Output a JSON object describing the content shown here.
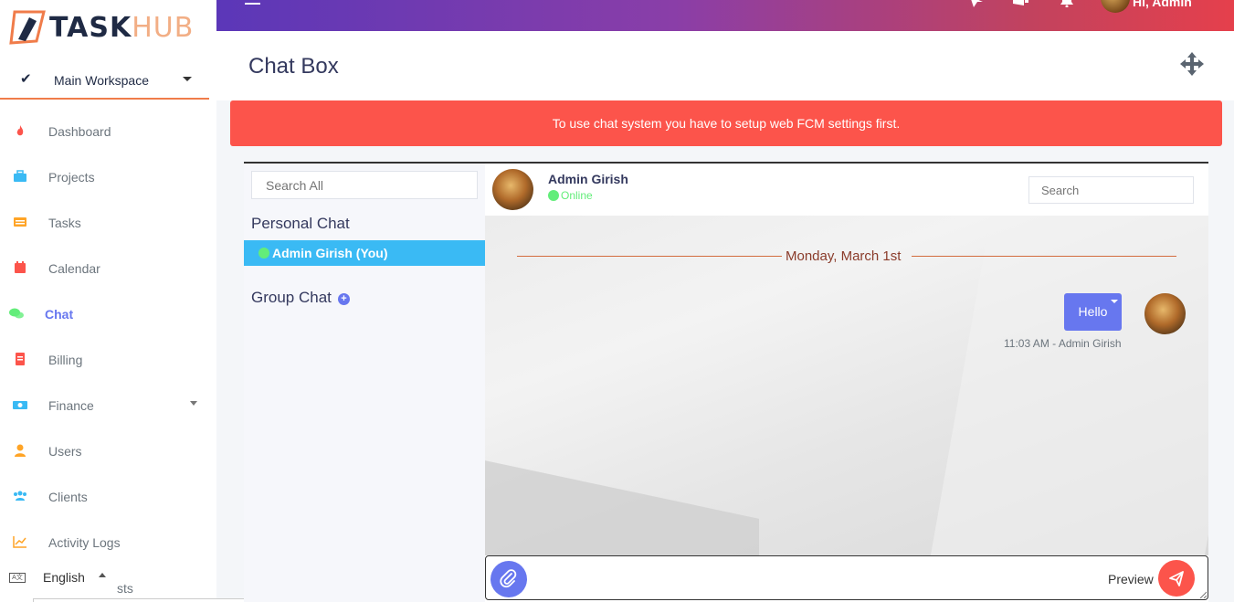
{
  "brand": {
    "name_bold": "TASK",
    "name_light": "HUB"
  },
  "workspace": {
    "label": "Main Workspace"
  },
  "sidebar": {
    "items": [
      {
        "label": "Dashboard",
        "icon": "fire-icon",
        "color": "#fc544b"
      },
      {
        "label": "Projects",
        "icon": "briefcase-icon",
        "color": "#3abaf4"
      },
      {
        "label": "Tasks",
        "icon": "list-icon",
        "color": "#ffa426"
      },
      {
        "label": "Calendar",
        "icon": "calendar-icon",
        "color": "#fc544b"
      },
      {
        "label": "Chat",
        "icon": "comments-icon",
        "color": "#63ed7a"
      },
      {
        "label": "Billing",
        "icon": "receipt-icon",
        "color": "#fc544b"
      },
      {
        "label": "Finance",
        "icon": "money-icon",
        "color": "#3abaf4"
      },
      {
        "label": "Users",
        "icon": "user-icon",
        "color": "#ffa426"
      },
      {
        "label": "Clients",
        "icon": "users-icon",
        "color": "#3abaf4"
      },
      {
        "label": "Activity Logs",
        "icon": "chart-line-icon",
        "color": "#ffa426"
      }
    ],
    "hidden_item_fragment": "sts",
    "language": "English"
  },
  "topbar": {
    "greeting": "Hi, Admin"
  },
  "page": {
    "title": "Chat Box"
  },
  "alert": {
    "text": "To use chat system you have to setup web FCM settings first."
  },
  "chat_list": {
    "search_placeholder": "Search All",
    "personal_heading": "Personal Chat",
    "group_heading": "Group Chat",
    "contacts": [
      {
        "name": "Admin Girish (You)",
        "online": true
      }
    ]
  },
  "chat": {
    "user_name": "Admin Girish",
    "user_status": "Online",
    "search_placeholder": "Search",
    "date_divider": "Monday, March 1st",
    "messages": [
      {
        "text": "Hello",
        "meta": "11:03 AM - Admin Girish"
      }
    ],
    "preview_label": "Preview"
  },
  "colors": {
    "accent": "#6777ef",
    "danger": "#fc544b",
    "info": "#3abaf4",
    "online": "#63ed7a"
  }
}
